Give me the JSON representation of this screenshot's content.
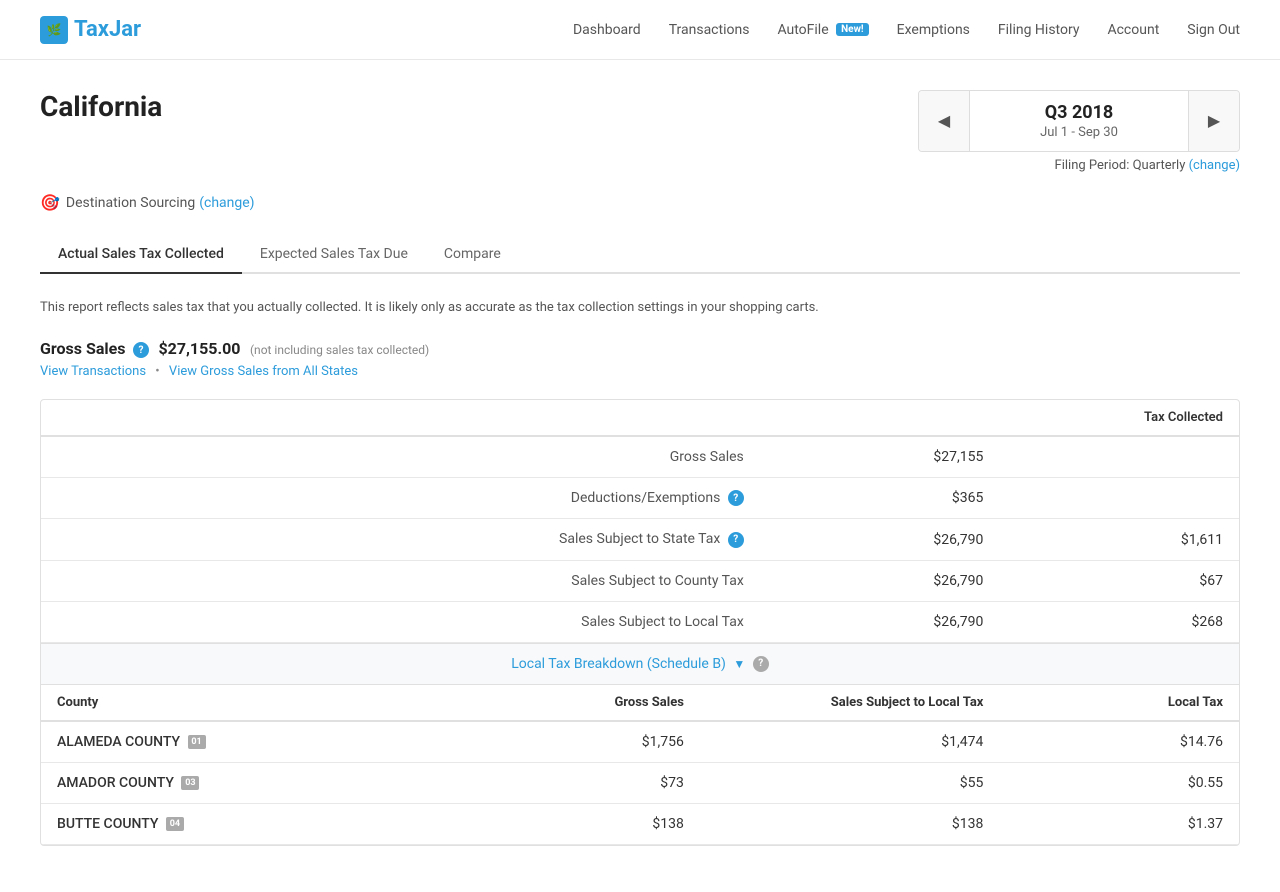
{
  "header": {
    "logo_text": "TaxJar",
    "nav": [
      {
        "label": "Dashboard",
        "href": "#",
        "badge": null
      },
      {
        "label": "Transactions",
        "href": "#",
        "badge": null
      },
      {
        "label": "AutoFile",
        "href": "#",
        "badge": "New!"
      },
      {
        "label": "Exemptions",
        "href": "#",
        "badge": null
      },
      {
        "label": "Filing History",
        "href": "#",
        "badge": null
      },
      {
        "label": "Account",
        "href": "#",
        "badge": null
      },
      {
        "label": "Sign Out",
        "href": "#",
        "badge": null
      }
    ]
  },
  "page": {
    "title": "California",
    "quarter_label": "Q3 2018",
    "quarter_dates": "Jul 1 - Sep 30",
    "filing_period_text": "Filing Period: Quarterly",
    "filing_period_change": "(change)",
    "sourcing_label": "Destination Sourcing",
    "sourcing_change": "(change)"
  },
  "tabs": [
    {
      "label": "Actual Sales Tax Collected",
      "active": true
    },
    {
      "label": "Expected Sales Tax Due",
      "active": false
    },
    {
      "label": "Compare",
      "active": false
    }
  ],
  "report": {
    "description": "This report reflects sales tax that you actually collected. It is likely only as accurate as the tax collection settings in your shopping carts.",
    "gross_sales_label": "Gross Sales",
    "gross_sales_amount": "$27,155.00",
    "gross_sales_note": "(not including sales tax collected)",
    "link_transactions": "View Transactions",
    "link_separator": "•",
    "link_gross_sales": "View Gross Sales from All States"
  },
  "table": {
    "header_tax_collected": "Tax Collected",
    "rows": [
      {
        "label": "Gross Sales",
        "amount": "$27,155",
        "tax": ""
      },
      {
        "label": "Deductions/Exemptions",
        "amount": "$365",
        "tax": ""
      },
      {
        "label": "Sales Subject to State Tax",
        "amount": "$26,790",
        "tax": "$1,611"
      },
      {
        "label": "Sales Subject to County Tax",
        "amount": "$26,790",
        "tax": "$67"
      },
      {
        "label": "Sales Subject to Local Tax",
        "amount": "$26,790",
        "tax": "$268"
      }
    ]
  },
  "breakdown": {
    "label": "Local Tax Breakdown (Schedule B)",
    "columns": [
      "County",
      "Gross Sales",
      "Sales Subject to Local Tax",
      "Local Tax"
    ],
    "rows": [
      {
        "county": "ALAMEDA COUNTY",
        "badge": "01",
        "gross_sales": "$1,756",
        "sales_subject": "$1,474",
        "local_tax": "$14.76"
      },
      {
        "county": "AMADOR COUNTY",
        "badge": "03",
        "gross_sales": "$73",
        "sales_subject": "$55",
        "local_tax": "$0.55"
      },
      {
        "county": "BUTTE COUNTY",
        "badge": "04",
        "gross_sales": "$138",
        "sales_subject": "$138",
        "local_tax": "$1.37"
      }
    ]
  }
}
